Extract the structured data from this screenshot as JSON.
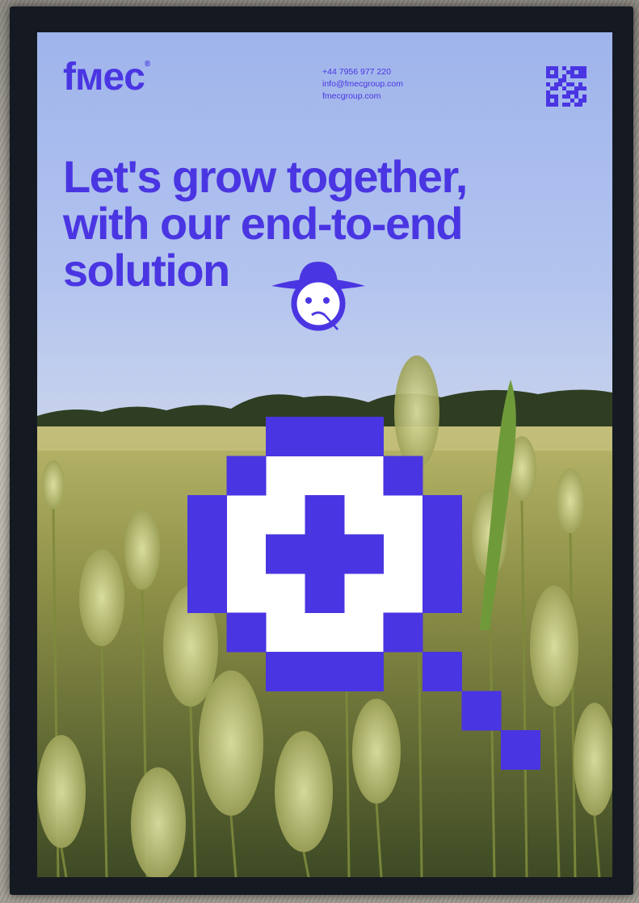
{
  "poster": {
    "brand": "fмec",
    "brand_mark": "®",
    "contact": {
      "phone": "+44 7956 977 220",
      "email": "info@fmecgroup.com",
      "website": "fmecgroup.com"
    },
    "headline": [
      "Let's grow together,",
      "with our end-to-end",
      "solution"
    ]
  },
  "colors": {
    "brand": "#4a35e2",
    "sky": "#a9bdf0",
    "wheat": "#c9cf8c",
    "frame": "#151a22"
  },
  "icons": [
    "qr-code-icon",
    "farmer-face-icon",
    "pixel-plus-pin-icon"
  ]
}
